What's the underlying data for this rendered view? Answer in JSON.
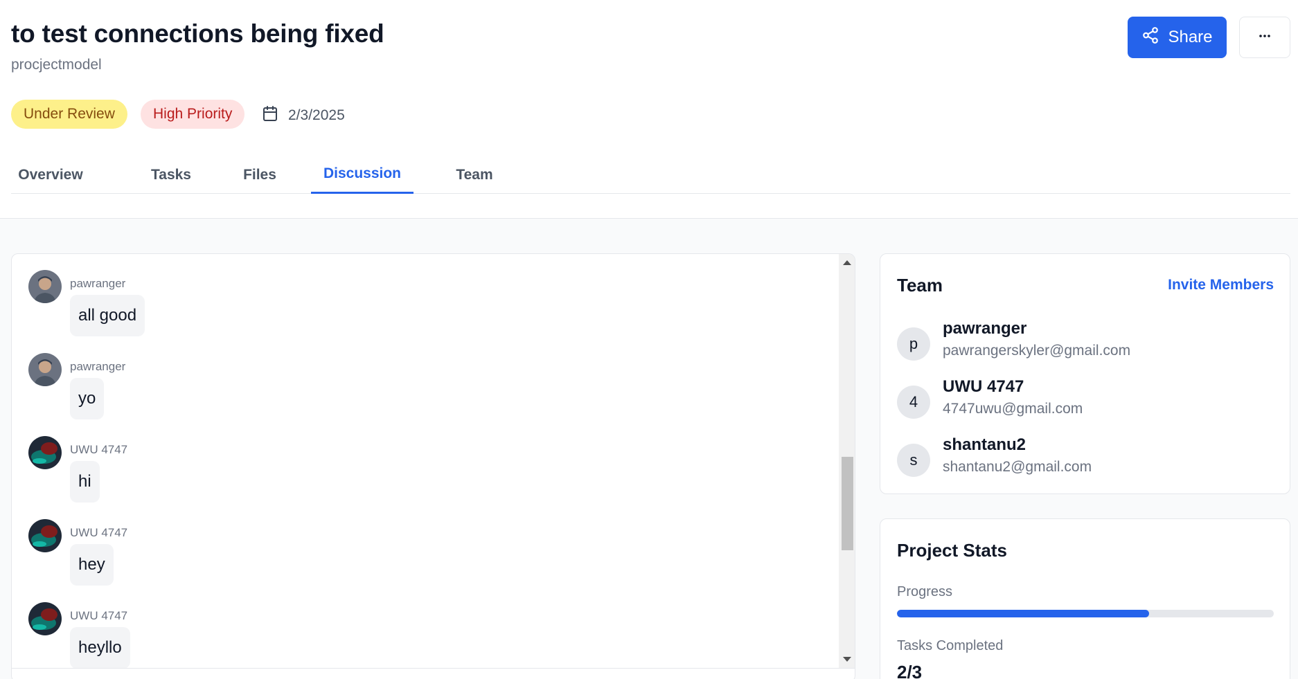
{
  "project": {
    "title": "to test connections being fixed",
    "subtitle": "procjectmodel",
    "status": "Under Review",
    "priority": "High Priority",
    "date": "2/3/2025"
  },
  "header_actions": {
    "share_label": "Share",
    "more_icon": "more-horizontal-icon"
  },
  "tabs": [
    {
      "label": "Overview",
      "active": false
    },
    {
      "label": "Tasks",
      "active": false
    },
    {
      "label": "Files",
      "active": false
    },
    {
      "label": "Discussion",
      "active": true
    },
    {
      "label": "Team",
      "active": false
    }
  ],
  "messages": [
    {
      "author": "pawranger",
      "text": "all good"
    },
    {
      "author": "pawranger",
      "text": "yo"
    },
    {
      "author": "UWU 4747",
      "text": "hi"
    },
    {
      "author": "UWU 4747",
      "text": "hey"
    },
    {
      "author": "UWU 4747",
      "text": "heyllo"
    }
  ],
  "team": {
    "title": "Team",
    "invite_label": "Invite Members",
    "members": [
      {
        "initial": "p",
        "name": "pawranger",
        "email": "pawrangerskyler@gmail.com"
      },
      {
        "initial": "4",
        "name": "UWU 4747",
        "email": "4747uwu@gmail.com"
      },
      {
        "initial": "s",
        "name": "shantanu2",
        "email": "shantanu2@gmail.com"
      }
    ]
  },
  "stats": {
    "title": "Project Stats",
    "progress_label": "Progress",
    "progress_fraction": 0.67,
    "tasks_completed_label": "Tasks Completed",
    "tasks_completed_value": "2/3"
  },
  "colors": {
    "accent": "#2563eb",
    "status_badge_bg": "#fdf08a",
    "priority_badge_bg": "#fee2e2"
  }
}
